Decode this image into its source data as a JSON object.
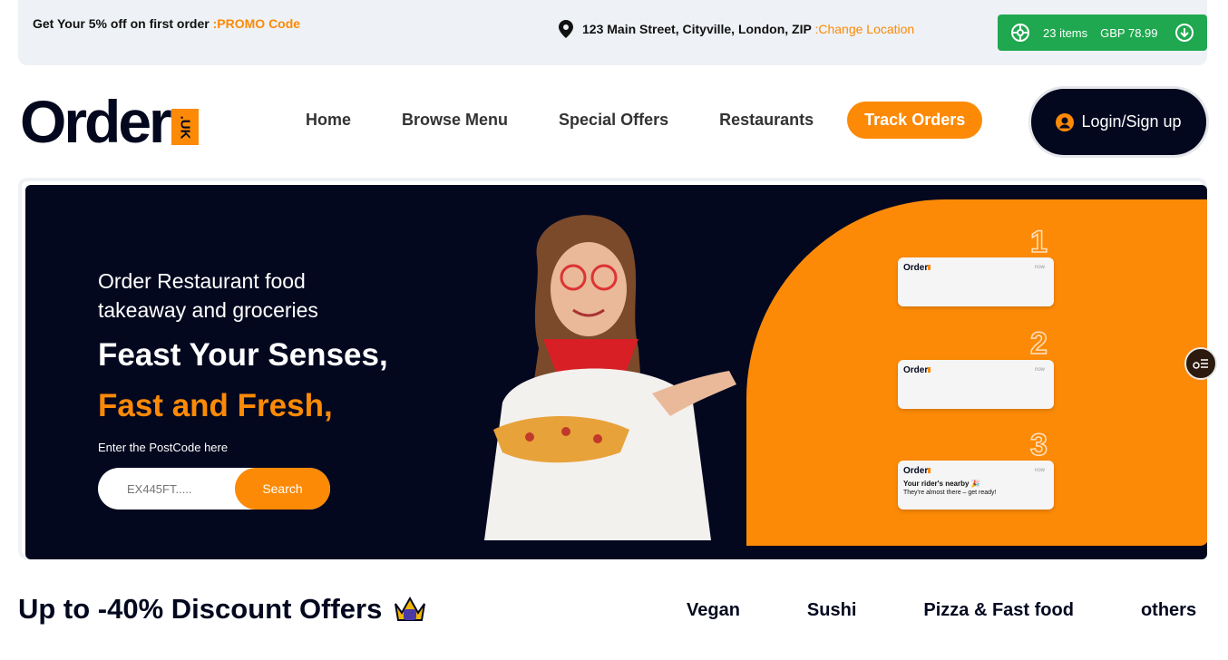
{
  "topbar": {
    "promo_text": "Get Your 5% off on first order",
    "promo_code": ":PROMO Code",
    "address": "123 Main Street, Cityville, London, ZIP",
    "change_location": ":Change Location",
    "cart_items": "23 items",
    "cart_total": "GBP 78.99"
  },
  "logo": {
    "word": "Order",
    "badge": ".UK"
  },
  "nav": {
    "items": [
      "Home",
      "Browse Menu",
      "Special Offers",
      "Restaurants",
      "Track Orders"
    ],
    "active": "Track Orders",
    "login": "Login/Sign up"
  },
  "hero": {
    "subtitle": "Order Restaurant food takeaway and groceries",
    "title_line1": "Feast Your Senses,",
    "title_line2": "Fast and Fresh,",
    "postcode_label": "Enter the PostCode here",
    "postcode_placeholder": "EX445FT.....",
    "search_button": "Search",
    "notifications": [
      {
        "step": "1",
        "brand": "Order",
        "time": "now",
        "title": "",
        "text": ""
      },
      {
        "step": "2",
        "brand": "Order",
        "time": "now",
        "title": "",
        "text": ""
      },
      {
        "step": "3",
        "brand": "Order",
        "time": "now",
        "title": "Your rider's nearby 🎉",
        "text": "They're almost there – get ready!"
      }
    ]
  },
  "offers": {
    "heading": "Up to -40% Discount Offers",
    "categories": [
      "Vegan",
      "Sushi",
      "Pizza & Fast food",
      "others"
    ]
  },
  "colors": {
    "accent": "#fc8a06",
    "dark": "#03081f",
    "cart_green": "#1fa84f",
    "topbar_bg": "#eef1f5"
  },
  "icons": [
    "location-pin-icon",
    "basket-icon",
    "download-arrow-icon",
    "user-icon",
    "menu-list-icon",
    "crown-icon"
  ]
}
